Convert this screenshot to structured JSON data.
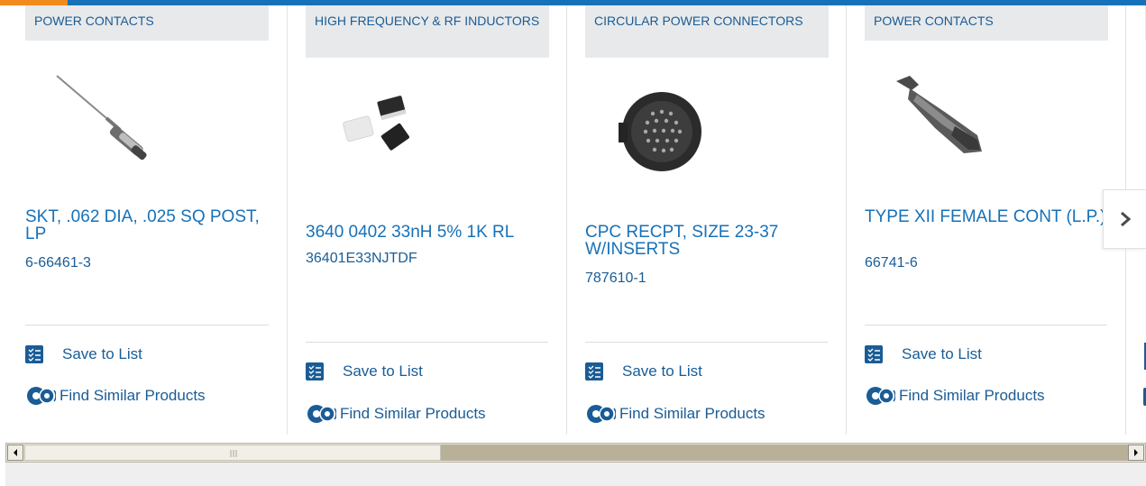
{
  "cards": [
    {
      "category": "POWER CONTACTS",
      "title": "SKT, .062 DIA, .025 SQ POST, LP",
      "part_number": "6-66461-3",
      "image": "power-contact-pin"
    },
    {
      "category": "HIGH FREQUENCY & RF INDUCTORS",
      "title": "3640 0402 33nH 5% 1K RL",
      "part_number": "36401E33NJTDF",
      "image": "smd-inductors"
    },
    {
      "category": "CIRCULAR POWER CONNECTORS",
      "title": "CPC RECPT, SIZE 23-37 W/INSERTS",
      "part_number": "787610-1",
      "image": "circular-connector"
    },
    {
      "category": "POWER CONTACTS",
      "title": "TYPE XII FEMALE CONT (L.P.)",
      "part_number": "66741-6",
      "image": "female-contact"
    }
  ],
  "actions": {
    "save_to_list": "Save to List",
    "find_similar": "Find Similar Products"
  },
  "carousel": {
    "next_icon": "chevron-right-icon"
  },
  "colors": {
    "link_blue": "#1a5c96",
    "accent_orange": "#f28b1e",
    "category_bg": "#e8e9ea",
    "top_bar": "#1671b8"
  }
}
